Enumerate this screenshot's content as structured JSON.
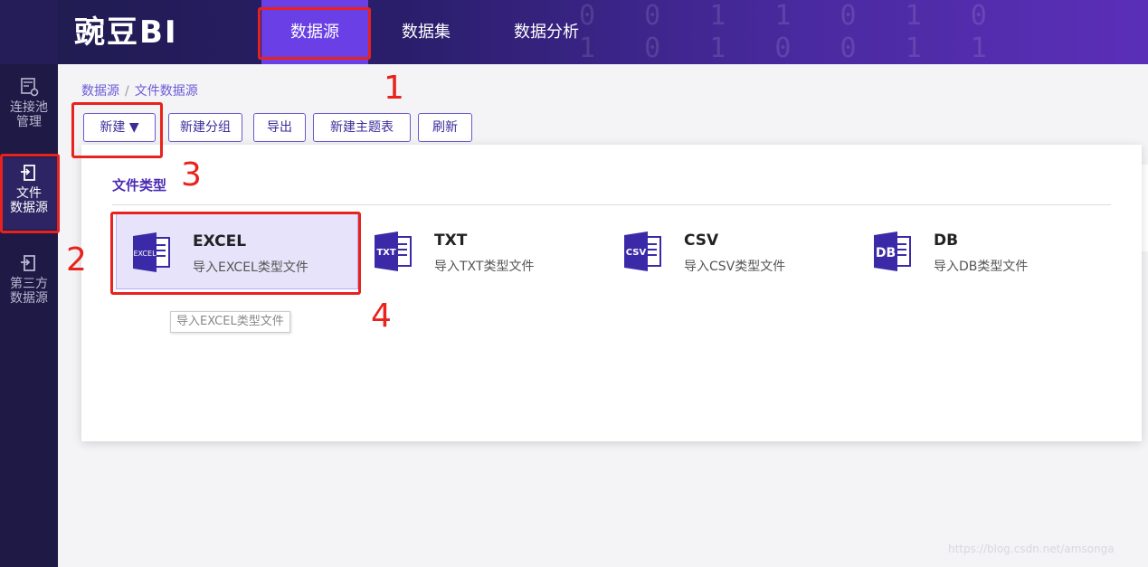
{
  "header": {
    "logo_text": "豌豆BI",
    "bg_digits_1": "0 0 1 1 0 1 0",
    "bg_digits_2": "1 0 1 0 0 1 1",
    "nav": [
      {
        "label": "数据源",
        "active": true
      },
      {
        "label": "数据集",
        "active": false
      },
      {
        "label": "数据分析",
        "active": false
      }
    ]
  },
  "sidebar": {
    "items": [
      {
        "label_line1": "连接池",
        "label_line2": "管理",
        "icon": "connection-pool-icon",
        "active": false
      },
      {
        "label_line1": "文件",
        "label_line2": "数据源",
        "icon": "file-datasource-icon",
        "active": true
      },
      {
        "label_line1": "第三方",
        "label_line2": "数据源",
        "icon": "third-party-datasource-icon",
        "active": false
      }
    ]
  },
  "breadcrumb": {
    "root": "数据源",
    "separator": "/",
    "current": "文件数据源"
  },
  "toolbar": {
    "new_label": "新建 ▼",
    "new_group_label": "新建分组",
    "export_label": "导出",
    "new_theme_table_label": "新建主题表",
    "refresh_label": "刷新"
  },
  "panel": {
    "title": "文件类型",
    "file_types": [
      {
        "name": "EXCEL",
        "desc": "导入EXCEL类型文件",
        "icon_text": "EXCEL"
      },
      {
        "name": "TXT",
        "desc": "导入TXT类型文件",
        "icon_text": "TXT"
      },
      {
        "name": "CSV",
        "desc": "导入CSV类型文件",
        "icon_text": "CSV"
      },
      {
        "name": "DB",
        "desc": "导入DB类型文件",
        "icon_text": "DB"
      }
    ],
    "tooltip": "导入EXCEL类型文件"
  },
  "annotations": {
    "n1": "1",
    "n2": "2",
    "n3": "3",
    "n4": "4"
  },
  "watermark": "https://blog.csdn.net/amsonga",
  "colors": {
    "accent": "#6a3fe6",
    "annotation_red": "#e8221d",
    "sidebar_bg": "#1e1a45"
  }
}
